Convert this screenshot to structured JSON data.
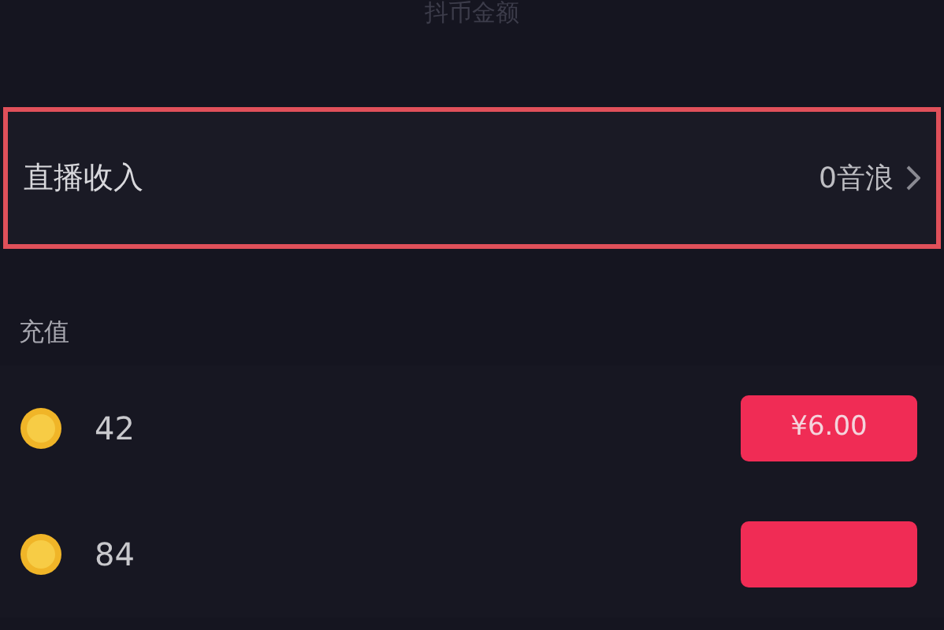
{
  "header": {
    "title": "抖币金额"
  },
  "income_row": {
    "label": "直播收入",
    "value": "0音浪",
    "highlighted": true
  },
  "section_title": "充值",
  "recharge_options": [
    {
      "amount": "42",
      "price": "¥6.00"
    },
    {
      "amount": "84"
    }
  ]
}
